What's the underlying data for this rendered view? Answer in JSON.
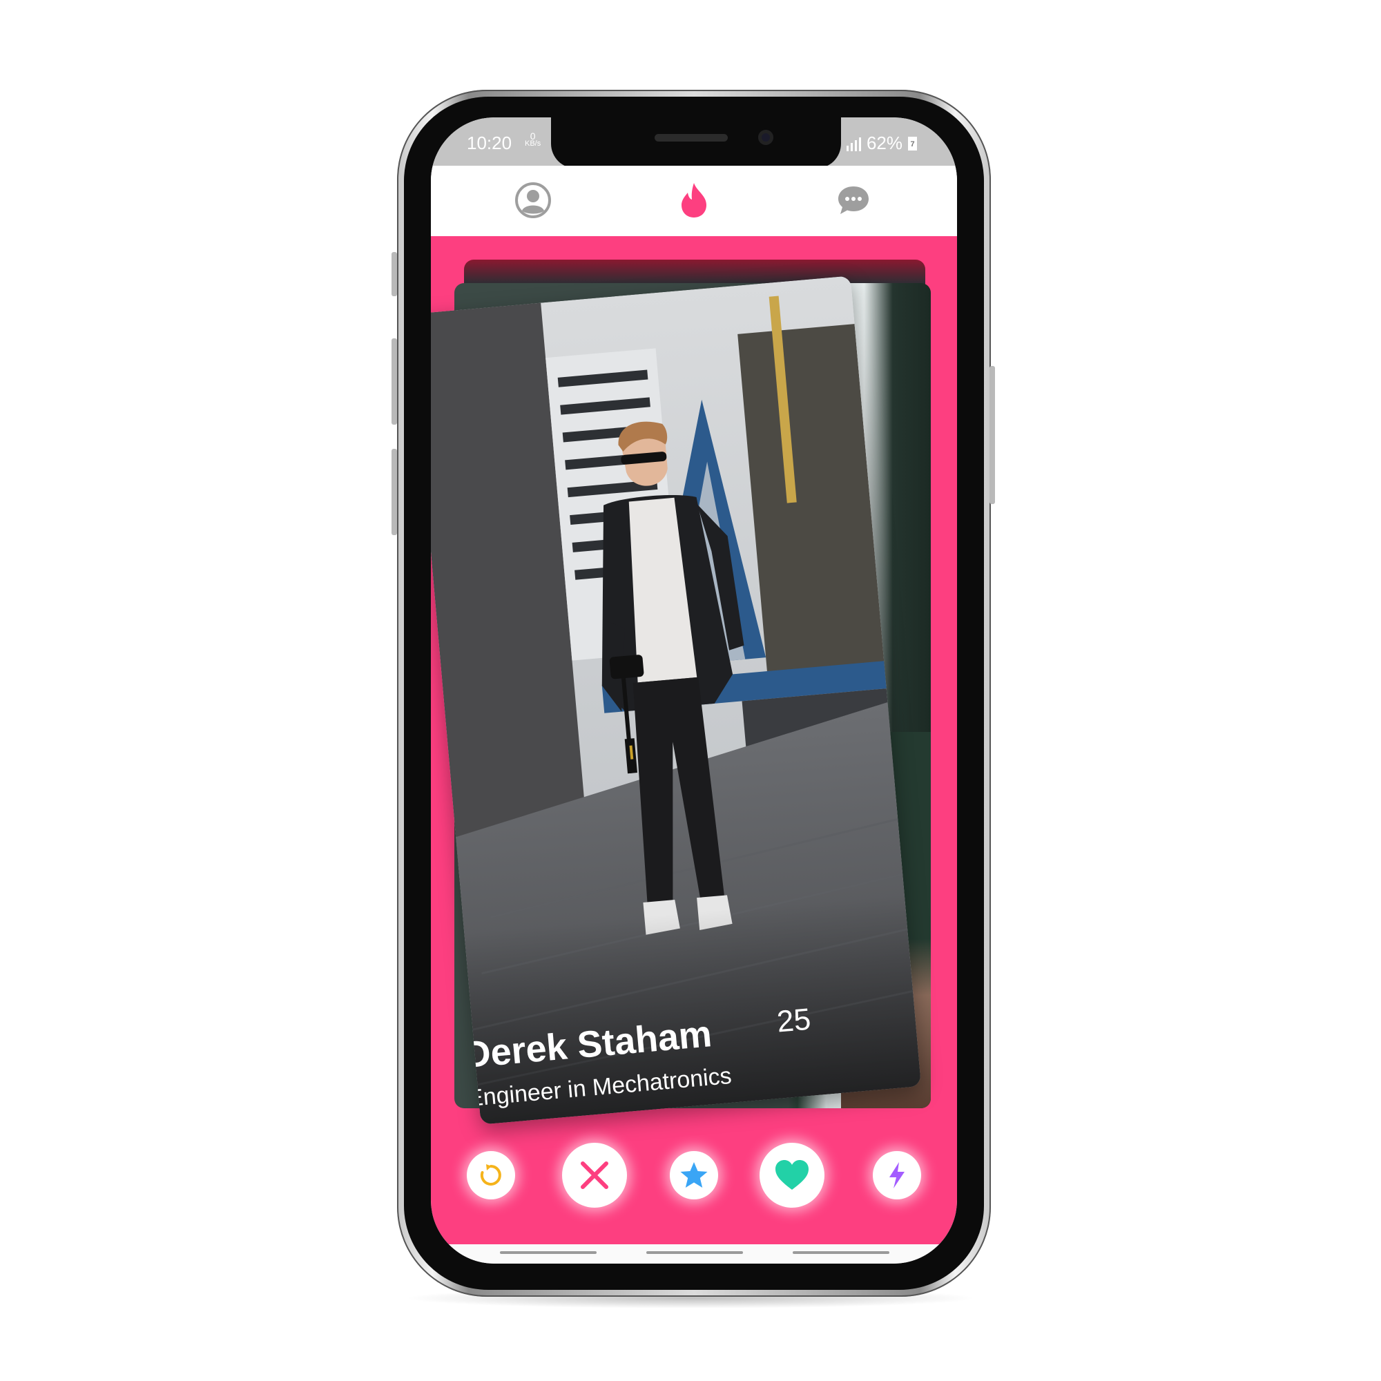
{
  "status_bar": {
    "time": "10:20",
    "data_rate_value": "0",
    "data_rate_unit": "KB/s",
    "battery_percent": "62%",
    "battery_badge": "7"
  },
  "top_nav": {
    "profile_icon": "user-circle-icon",
    "flame_icon": "flame-icon",
    "messages_icon": "chat-bubble-icon",
    "accent_color": "#fd3f80",
    "inactive_color": "#9e9e9e"
  },
  "card": {
    "name": "Derek Staham",
    "age": "25",
    "job": "Engineer in Mechatronics"
  },
  "actions": [
    {
      "icon": "rewind-icon",
      "color": "#f5b31b"
    },
    {
      "icon": "close-icon",
      "color": "#fd3f80"
    },
    {
      "icon": "star-icon",
      "color": "#3aa5f5"
    },
    {
      "icon": "heart-icon",
      "color": "#22d1a7"
    },
    {
      "icon": "lightning-icon",
      "color": "#a35cff"
    }
  ]
}
